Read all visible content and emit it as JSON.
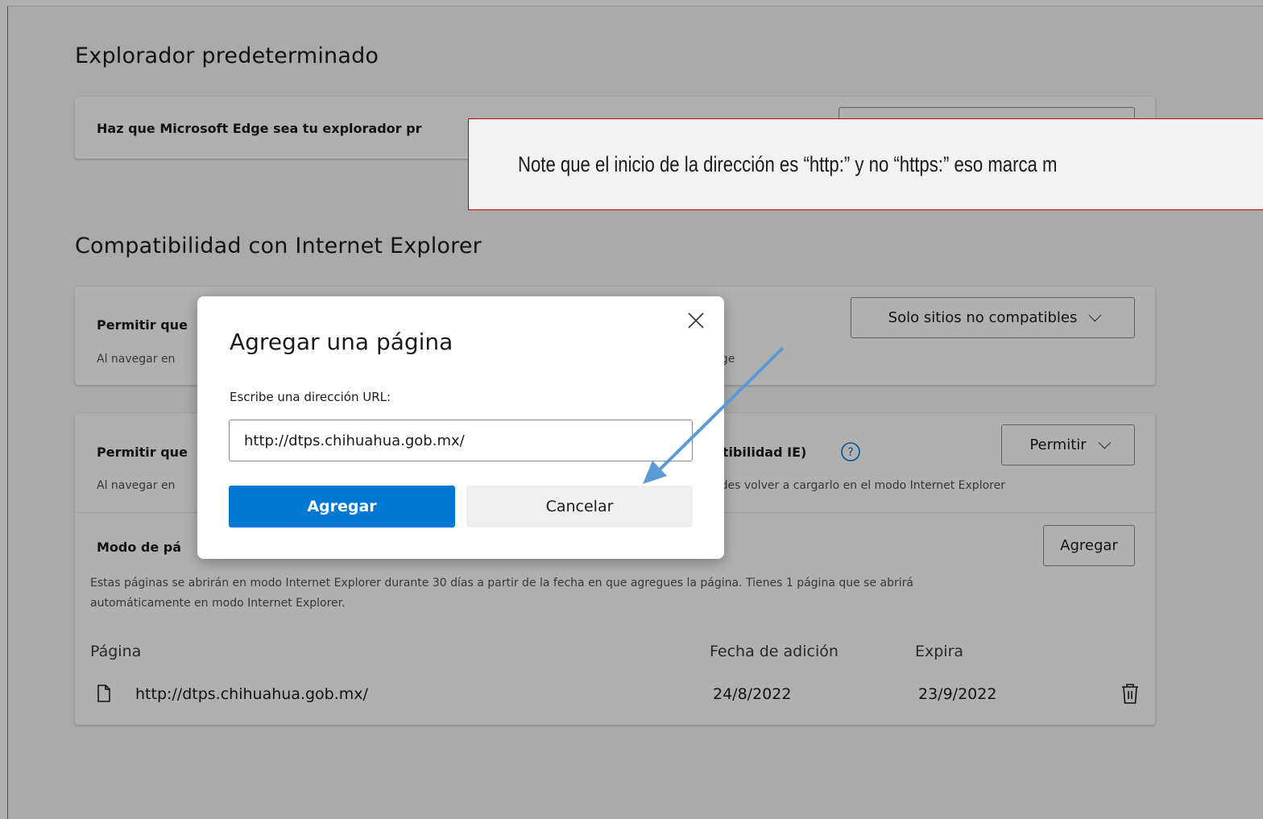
{
  "default_browser": {
    "section_title": "Explorador predeterminado",
    "row_label": "Haz que Microsoft Edge sea tu explorador pr"
  },
  "ie_compat": {
    "section_title": "Compatibilidad con Internet Explorer",
    "row1": {
      "title": "Permitir que",
      "desc_left": "Al navegar en",
      "desc_right": "dge",
      "dropdown_value": "Solo sitios no compatibles"
    },
    "row2": {
      "title_left": "Permitir que",
      "title_right": "atibilidad IE)",
      "desc_left": "Al navegar en",
      "desc_right": "edes volver a cargarlo en el modo Internet Explorer",
      "dropdown_value": "Permitir"
    },
    "row3": {
      "title": "Modo de pá",
      "add_button": "Agregar",
      "desc_line1": "Estas páginas se abrirán en modo Internet Explorer durante 30 días a partir de la fecha en que agregues la página. Tienes 1 página que se abrirá",
      "desc_line2": "automáticamente en modo Internet Explorer."
    },
    "table": {
      "col_page": "Página",
      "col_date_added": "Fecha de adición",
      "col_expires": "Expira",
      "rows": [
        {
          "page": "http://dtps.chihuahua.gob.mx/",
          "date_added": "24/8/2022",
          "expires": "23/9/2022"
        }
      ]
    }
  },
  "dialog": {
    "title": "Agregar una página",
    "url_label": "Escribe una dirección URL:",
    "url_value": "http://dtps.chihuahua.gob.mx/",
    "add_label": "Agregar",
    "cancel_label": "Cancelar"
  },
  "annotation": {
    "note": "Note que el inicio de la dirección es “http:” y no “https:” eso marca m",
    "border_color": "#c00000",
    "arrow_color": "#5b9bd5"
  },
  "colors": {
    "accent": "#0078d4",
    "help_icon": "#0078d4"
  },
  "icons": {
    "close": "close-icon",
    "help": "help-icon",
    "page": "page-icon",
    "delete": "trash-icon",
    "dropdown": "chevron-down-icon"
  }
}
